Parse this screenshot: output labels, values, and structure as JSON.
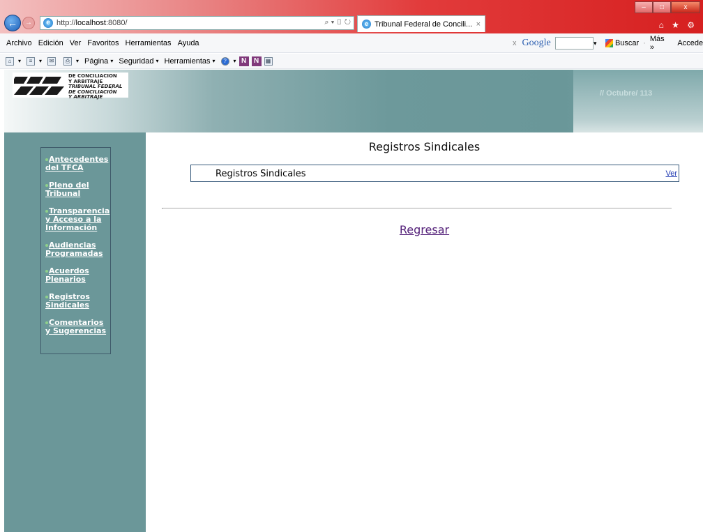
{
  "browser": {
    "address_prefix": "http://",
    "address_host": "localhost",
    "address_rest": ":8080/",
    "address_tools": "⌕ ▾ ▯ ↻",
    "tab_title": "Tribunal Federal de Concili...",
    "tab_close": "×",
    "window_controls": [
      "–",
      "□",
      "x"
    ],
    "toolbar_icons": "⌂ ★ ⚙"
  },
  "menubar": {
    "items": [
      "Archivo",
      "Edición",
      "Ver",
      "Favoritos",
      "Herramientas",
      "Ayuda"
    ]
  },
  "google_bar": {
    "close": "x",
    "logo": "Google",
    "search_label": "Buscar",
    "more_label": "Más »",
    "login_label": "Acceder"
  },
  "commandbar": {
    "items": [
      "Página",
      "Seguridad",
      "Herramientas"
    ]
  },
  "header": {
    "logo_lines": [
      "DE CONCILIACION",
      "Y ARBITRAJE",
      "TRIBUNAL FEDERAL",
      "DE CONCILIACIÓN",
      "Y ARBITRAJE"
    ],
    "date_text": "// Octubre/ 113"
  },
  "sidebar": {
    "items": [
      {
        "label": "Antecedentes del TFCA"
      },
      {
        "label": "Pleno del Tribunal"
      },
      {
        "label": "Transparencia y Acceso a la Información"
      },
      {
        "label": "Audiencias Programadas"
      },
      {
        "label": "Acuerdos Plenarios"
      },
      {
        "label": "Registros Sindicales"
      },
      {
        "label": "Comentarios y Sugerencias"
      }
    ]
  },
  "main": {
    "title": "Registros Sindicales",
    "row_label": "Registros Sindicales",
    "row_link": "Ver",
    "back_link": "Regresar"
  },
  "colors": {
    "sidebar_bg": "#6b9799",
    "link_visited": "#55227a",
    "link": "#1a35b0"
  }
}
